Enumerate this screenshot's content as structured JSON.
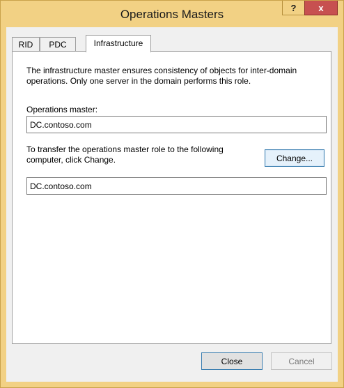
{
  "window": {
    "title": "Operations Masters",
    "help_glyph": "?",
    "close_glyph": "x"
  },
  "tabs": [
    {
      "label": "RID",
      "active": false
    },
    {
      "label": "PDC",
      "active": false
    },
    {
      "label": "Infrastructure",
      "active": true
    }
  ],
  "infrastructure": {
    "description": "The infrastructure master ensures consistency of objects for inter-domain operations. Only one server in the domain performs this role.",
    "operations_master_label": "Operations master:",
    "operations_master_value": "DC.contoso.com",
    "transfer_text": "To transfer the operations master role to the following computer, click Change.",
    "change_label": "Change...",
    "target_value": "DC.contoso.com"
  },
  "footer": {
    "close_label": "Close",
    "cancel_label": "Cancel"
  },
  "colors": {
    "title_bar": "#f2d184",
    "close_button": "#c75050",
    "focus_border": "#3c7fb1"
  }
}
